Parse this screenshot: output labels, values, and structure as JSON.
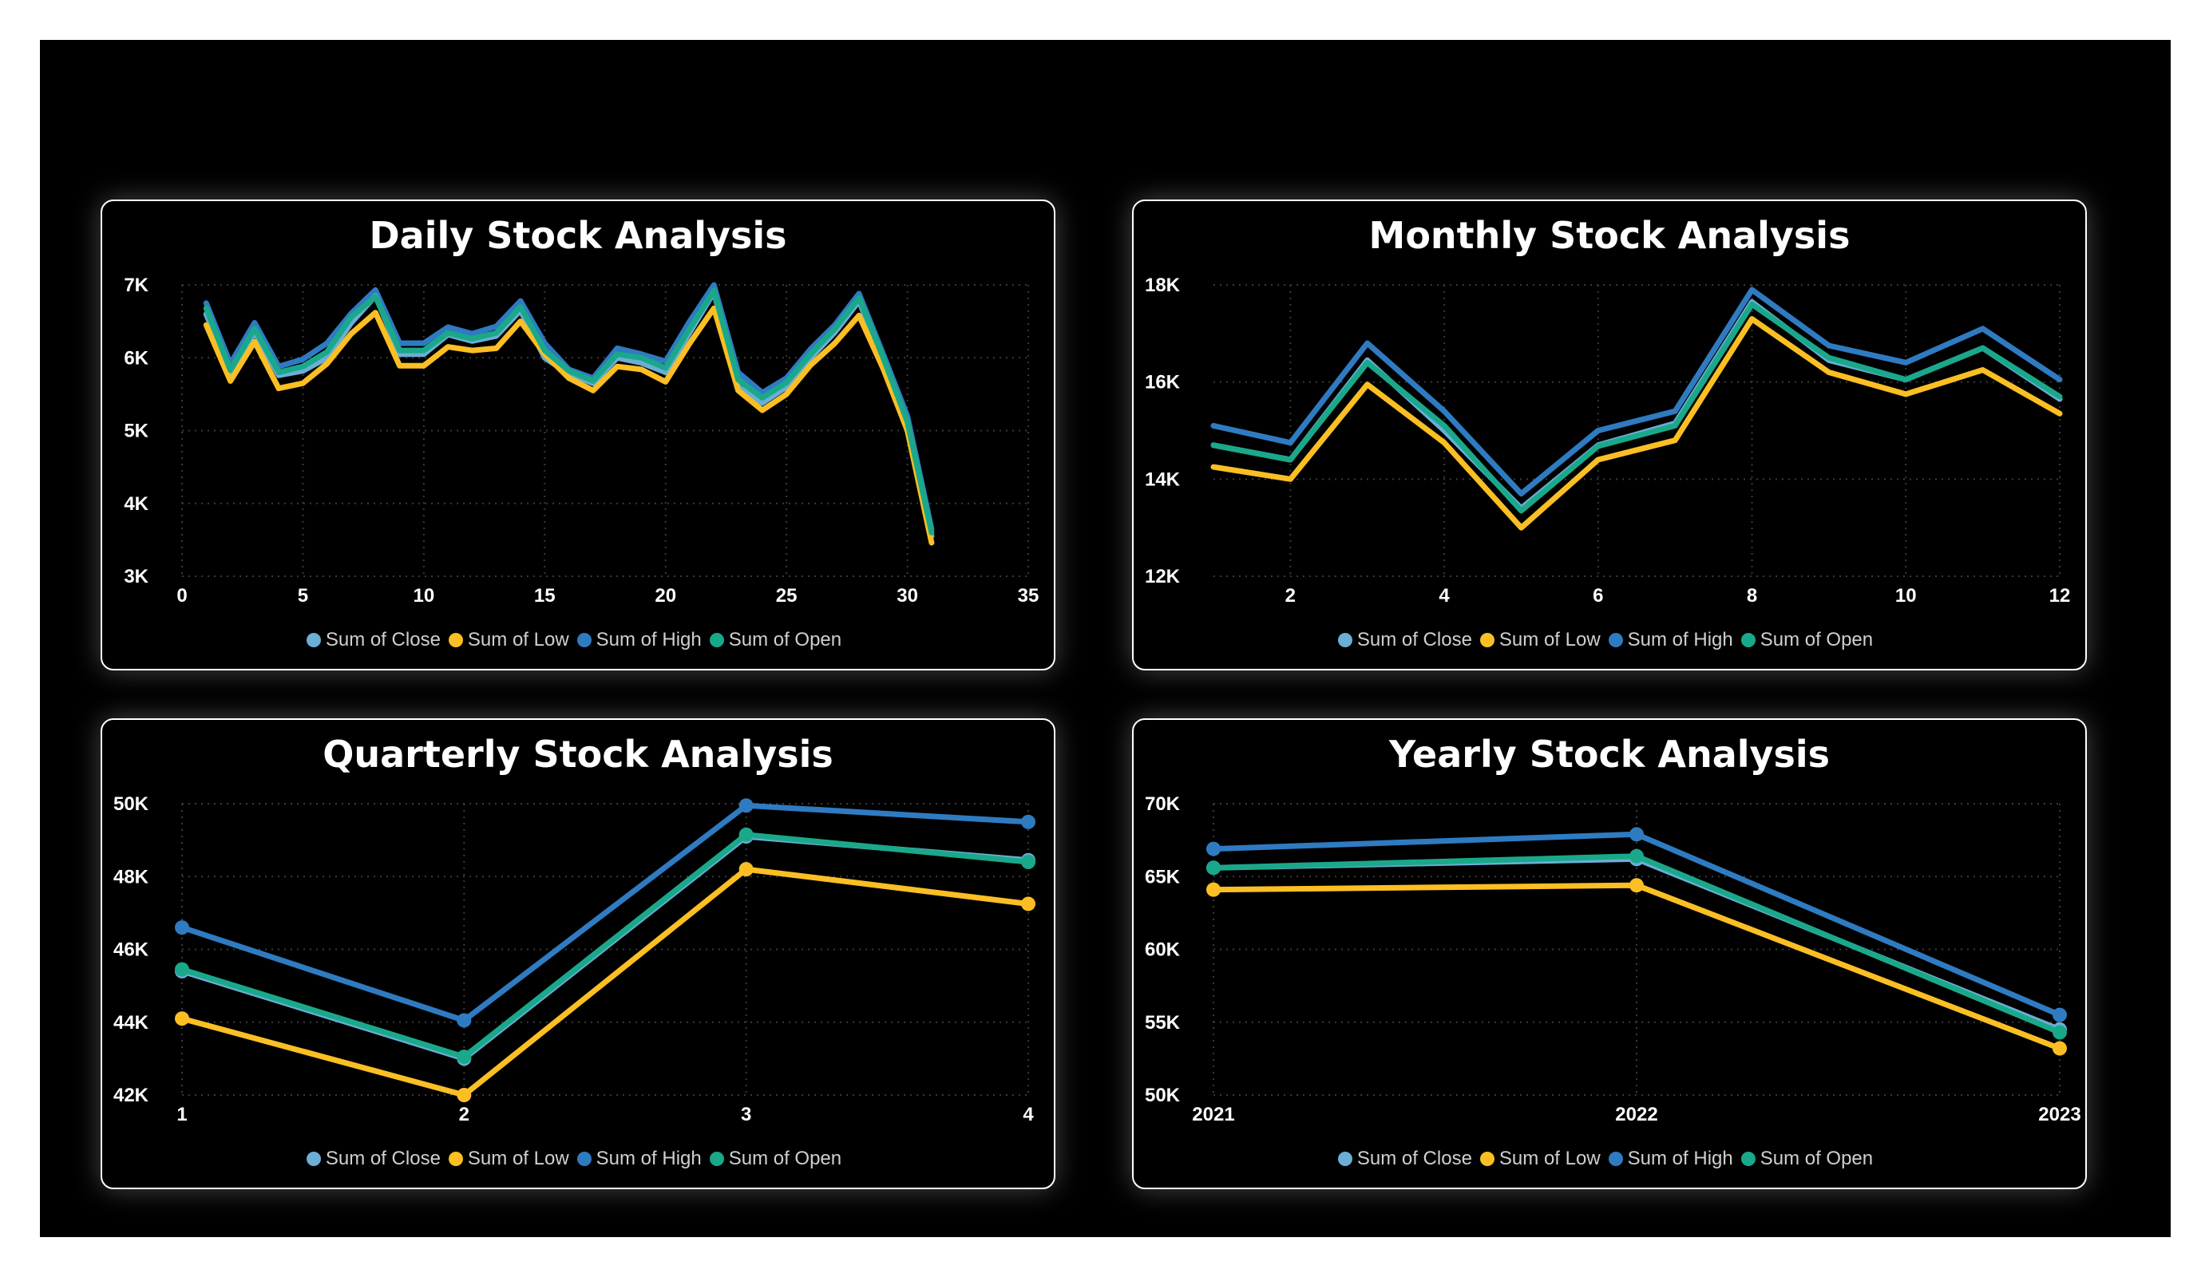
{
  "legend_labels": [
    "Sum of Close",
    "Sum of Low",
    "Sum of High",
    "Sum of Open"
  ],
  "colors": {
    "close": "#6baed6",
    "low": "#fbbf24",
    "high": "#2f7bc2",
    "open": "#1aa88a",
    "grid": "#3a3a3a",
    "axis_text": "#ffffff",
    "background": "#000000"
  },
  "chart_data": [
    {
      "type": "line",
      "title": "Daily Stock Analysis",
      "xlabel": "",
      "ylabel": "",
      "xlim": [
        0,
        35
      ],
      "ylim": [
        3000,
        7000
      ],
      "x_ticks": [
        0,
        5,
        10,
        15,
        20,
        25,
        30,
        35
      ],
      "x_tick_labels": [
        "0",
        "5",
        "10",
        "15",
        "20",
        "25",
        "30",
        "35"
      ],
      "y_ticks": [
        3000,
        4000,
        5000,
        6000,
        7000
      ],
      "y_tick_labels": [
        "3K",
        "4K",
        "5K",
        "6K",
        "7K"
      ],
      "markers": false,
      "legend": "bottom",
      "grid": true,
      "x": [
        1,
        2,
        3,
        4,
        5,
        6,
        7,
        8,
        9,
        10,
        11,
        12,
        13,
        14,
        15,
        16,
        17,
        18,
        19,
        20,
        21,
        22,
        23,
        24,
        25,
        26,
        27,
        28,
        29,
        30,
        31
      ],
      "series": [
        {
          "name": "Sum of Close",
          "color_key": "close",
          "values": [
            6600,
            5780,
            6350,
            5760,
            5820,
            6000,
            6480,
            6850,
            6050,
            6050,
            6320,
            6230,
            6300,
            6650,
            6000,
            5780,
            5650,
            6000,
            5930,
            5800,
            6350,
            6900,
            5600,
            5380,
            5600,
            6000,
            6350,
            6780,
            5950,
            5050,
            3550
          ]
        },
        {
          "name": "Sum of Low",
          "color_key": "low",
          "values": [
            6450,
            5680,
            6220,
            5580,
            5650,
            5920,
            6330,
            6620,
            5890,
            5890,
            6150,
            6100,
            6130,
            6500,
            6050,
            5720,
            5550,
            5880,
            5840,
            5670,
            6200,
            6680,
            5550,
            5280,
            5500,
            5900,
            6200,
            6580,
            5850,
            5000,
            3460
          ]
        },
        {
          "name": "Sum of High",
          "color_key": "high",
          "values": [
            6750,
            5920,
            6480,
            5880,
            5980,
            6200,
            6610,
            6930,
            6200,
            6200,
            6420,
            6330,
            6430,
            6780,
            6200,
            5840,
            5720,
            6130,
            6050,
            5950,
            6500,
            7000,
            5800,
            5520,
            5720,
            6120,
            6450,
            6880,
            6050,
            5200,
            3650
          ]
        },
        {
          "name": "Sum of Open",
          "color_key": "open",
          "values": [
            6680,
            5830,
            6400,
            5800,
            5880,
            6080,
            6560,
            6840,
            6100,
            6100,
            6340,
            6260,
            6340,
            6700,
            6100,
            5820,
            5680,
            6050,
            6000,
            5860,
            6400,
            6920,
            5700,
            5450,
            5660,
            6050,
            6400,
            6820,
            6000,
            5120,
            3600
          ]
        }
      ]
    },
    {
      "type": "line",
      "title": "Monthly Stock Analysis",
      "xlabel": "",
      "ylabel": "",
      "xlim": [
        1,
        12
      ],
      "ylim": [
        12000,
        18000
      ],
      "x_ticks": [
        2,
        4,
        6,
        8,
        10,
        12
      ],
      "x_tick_labels": [
        "2",
        "4",
        "6",
        "8",
        "10",
        "12"
      ],
      "y_ticks": [
        12000,
        14000,
        16000,
        18000
      ],
      "y_tick_labels": [
        "12K",
        "14K",
        "16K",
        "18K"
      ],
      "markers": false,
      "legend": "bottom",
      "grid": true,
      "x": [
        1,
        2,
        3,
        4,
        5,
        6,
        7,
        8,
        9,
        10,
        11,
        12
      ],
      "series": [
        {
          "name": "Sum of Close",
          "color_key": "close",
          "values": [
            14700,
            14400,
            16450,
            15000,
            13400,
            14700,
            15150,
            17650,
            16450,
            16050,
            16700,
            15650
          ]
        },
        {
          "name": "Sum of Low",
          "color_key": "low",
          "values": [
            14250,
            14000,
            15950,
            14750,
            13000,
            14400,
            14800,
            17300,
            16200,
            15750,
            16250,
            15350
          ]
        },
        {
          "name": "Sum of High",
          "color_key": "high",
          "values": [
            15100,
            14750,
            16800,
            15400,
            13700,
            15000,
            15400,
            17900,
            16750,
            16400,
            17100,
            16050
          ]
        },
        {
          "name": "Sum of Open",
          "color_key": "open",
          "values": [
            14700,
            14400,
            16400,
            15100,
            13350,
            14680,
            15100,
            17600,
            16500,
            16050,
            16700,
            15700
          ]
        }
      ]
    },
    {
      "type": "line",
      "title": "Quarterly Stock Analysis",
      "xlabel": "",
      "ylabel": "",
      "xlim": [
        1,
        4
      ],
      "ylim": [
        42000,
        50000
      ],
      "x_ticks": [
        1,
        2,
        3,
        4
      ],
      "x_tick_labels": [
        "1",
        "2",
        "3",
        "4"
      ],
      "y_ticks": [
        42000,
        44000,
        46000,
        48000,
        50000
      ],
      "y_tick_labels": [
        "42K",
        "44K",
        "46K",
        "48K",
        "50K"
      ],
      "markers": true,
      "legend": "bottom",
      "grid": true,
      "x": [
        1,
        2,
        3,
        4
      ],
      "series": [
        {
          "name": "Sum of Close",
          "color_key": "close",
          "values": [
            45400,
            43000,
            49100,
            48450
          ]
        },
        {
          "name": "Sum of Low",
          "color_key": "low",
          "values": [
            44100,
            42000,
            48200,
            47250
          ]
        },
        {
          "name": "Sum of High",
          "color_key": "high",
          "values": [
            46600,
            44050,
            49950,
            49500
          ]
        },
        {
          "name": "Sum of Open",
          "color_key": "open",
          "values": [
            45450,
            43050,
            49150,
            48400
          ]
        }
      ]
    },
    {
      "type": "line",
      "title": "Yearly Stock Analysis",
      "xlabel": "",
      "ylabel": "",
      "xlim": [
        2021,
        2023
      ],
      "ylim": [
        50000,
        70000
      ],
      "x_ticks": [
        2021,
        2022,
        2023
      ],
      "x_tick_labels": [
        "2021",
        "2022",
        "2023"
      ],
      "y_ticks": [
        50000,
        55000,
        60000,
        65000,
        70000
      ],
      "y_tick_labels": [
        "50K",
        "55K",
        "60K",
        "65K",
        "70K"
      ],
      "markers": true,
      "legend": "bottom",
      "grid": true,
      "x": [
        2021,
        2022,
        2023
      ],
      "series": [
        {
          "name": "Sum of Close",
          "color_key": "close",
          "values": [
            65600,
            66200,
            54500
          ]
        },
        {
          "name": "Sum of Low",
          "color_key": "low",
          "values": [
            64100,
            64400,
            53200
          ]
        },
        {
          "name": "Sum of High",
          "color_key": "high",
          "values": [
            66900,
            67900,
            55500
          ]
        },
        {
          "name": "Sum of Open",
          "color_key": "open",
          "values": [
            65600,
            66400,
            54300
          ]
        }
      ]
    }
  ]
}
